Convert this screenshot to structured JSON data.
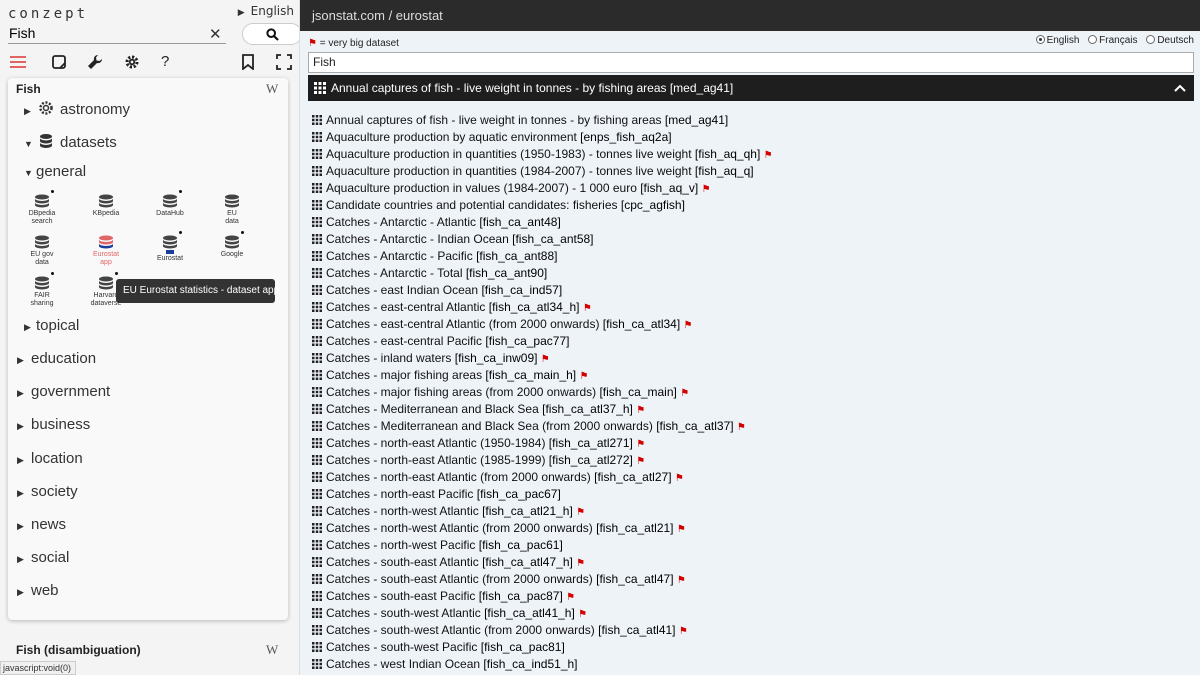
{
  "left": {
    "logo": "conzept",
    "language": "English",
    "search_value": "Fish",
    "card_title": "Fish",
    "wiki_letter": "W",
    "tree": {
      "astronomy": "astronomy",
      "datasets": "datasets",
      "general": "general",
      "topical": "topical",
      "education": "education",
      "government": "government",
      "business": "business",
      "location": "location",
      "society": "society",
      "news": "news",
      "social": "social",
      "web": "web"
    },
    "apps": [
      {
        "l1": "DBpedia",
        "l2": "search"
      },
      {
        "l1": "KBpedia",
        "l2": ""
      },
      {
        "l1": "DataHub",
        "l2": ""
      },
      {
        "l1": "EU",
        "l2": "data"
      },
      {
        "l1": "EU gov",
        "l2": "data"
      },
      {
        "l1": "Eurostat",
        "l2": "app"
      },
      {
        "l1": "Eurostat",
        "l2": ""
      },
      {
        "l1": "Google",
        "l2": ""
      },
      {
        "l1": "FAIR",
        "l2": "sharing"
      },
      {
        "l1": "Harvard",
        "l2": "dataverse"
      }
    ],
    "tooltip": "EU Eurostat statistics - dataset app",
    "disambiguation": "Fish (disambiguation)",
    "status": "javascript:void(0)"
  },
  "right": {
    "title": "jsonstat.com / eurostat",
    "legend": "= very big dataset",
    "languages": [
      "English",
      "Français",
      "Deutsch"
    ],
    "filter_value": "Fish",
    "selected": "Annual captures of fish - live weight in tonnes - by fishing areas [med_ag41]",
    "datasets": [
      {
        "text": "Annual captures of fish - live weight in tonnes - by fishing areas",
        "code": "[med_ag41]",
        "big": false
      },
      {
        "text": "Aquaculture production by aquatic environment",
        "code": "[enps_fish_aq2a]",
        "big": false
      },
      {
        "text": "Aquaculture production in quantities (1950-1983) - tonnes live weight",
        "code": "[fish_aq_qh]",
        "big": true
      },
      {
        "text": "Aquaculture production in quantities (1984-2007) - tonnes live weight",
        "code": "[fish_aq_q]",
        "big": false
      },
      {
        "text": "Aquaculture production in values (1984-2007) - 1 000 euro",
        "code": "[fish_aq_v]",
        "big": true
      },
      {
        "text": "Candidate countries and potential candidates: fisheries",
        "code": "[cpc_agfish]",
        "big": false
      },
      {
        "text": "Catches - Antarctic - Atlantic",
        "code": "[fish_ca_ant48]",
        "big": false
      },
      {
        "text": "Catches - Antarctic - Indian Ocean",
        "code": "[fish_ca_ant58]",
        "big": false
      },
      {
        "text": "Catches - Antarctic - Pacific",
        "code": "[fish_ca_ant88]",
        "big": false
      },
      {
        "text": "Catches - Antarctic - Total",
        "code": "[fish_ca_ant90]",
        "big": false
      },
      {
        "text": "Catches - east Indian Ocean",
        "code": "[fish_ca_ind57]",
        "big": false
      },
      {
        "text": "Catches - east-central Atlantic",
        "code": "[fish_ca_atl34_h]",
        "big": true
      },
      {
        "text": "Catches - east-central Atlantic (from 2000 onwards)",
        "code": "[fish_ca_atl34]",
        "big": true
      },
      {
        "text": "Catches - east-central Pacific",
        "code": "[fish_ca_pac77]",
        "big": false
      },
      {
        "text": "Catches - inland waters",
        "code": "[fish_ca_inw09]",
        "big": true
      },
      {
        "text": "Catches - major fishing areas",
        "code": "[fish_ca_main_h]",
        "big": true
      },
      {
        "text": "Catches - major fishing areas (from 2000 onwards)",
        "code": "[fish_ca_main]",
        "big": true
      },
      {
        "text": "Catches - Mediterranean and Black Sea",
        "code": "[fish_ca_atl37_h]",
        "big": true
      },
      {
        "text": "Catches - Mediterranean and Black Sea (from 2000 onwards)",
        "code": "[fish_ca_atl37]",
        "big": true
      },
      {
        "text": "Catches - north-east Atlantic (1950-1984)",
        "code": "[fish_ca_atl271]",
        "big": true
      },
      {
        "text": "Catches - north-east Atlantic (1985-1999)",
        "code": "[fish_ca_atl272]",
        "big": true
      },
      {
        "text": "Catches - north-east Atlantic (from 2000 onwards)",
        "code": "[fish_ca_atl27]",
        "big": true
      },
      {
        "text": "Catches - north-east Pacific",
        "code": "[fish_ca_pac67]",
        "big": false
      },
      {
        "text": "Catches - north-west Atlantic",
        "code": "[fish_ca_atl21_h]",
        "big": true
      },
      {
        "text": "Catches - north-west Atlantic (from 2000 onwards)",
        "code": "[fish_ca_atl21]",
        "big": true
      },
      {
        "text": "Catches - north-west Pacific",
        "code": "[fish_ca_pac61]",
        "big": false
      },
      {
        "text": "Catches - south-east Atlantic",
        "code": "[fish_ca_atl47_h]",
        "big": true
      },
      {
        "text": "Catches - south-east Atlantic (from 2000 onwards)",
        "code": "[fish_ca_atl47]",
        "big": true
      },
      {
        "text": "Catches - south-east Pacific",
        "code": "[fish_ca_pac87]",
        "big": true
      },
      {
        "text": "Catches - south-west Atlantic",
        "code": "[fish_ca_atl41_h]",
        "big": true
      },
      {
        "text": "Catches - south-west Atlantic (from 2000 onwards)",
        "code": "[fish_ca_atl41]",
        "big": true
      },
      {
        "text": "Catches - south-west Pacific",
        "code": "[fish_ca_pac81]",
        "big": false
      },
      {
        "text": "Catches - west Indian Ocean",
        "code": "[fish_ca_ind51_h]",
        "big": false
      }
    ]
  },
  "colors": {
    "accent": "#e06666",
    "flag": "#d40000",
    "topbar": "#2b2b2b",
    "main_bg": "#eef3f8"
  }
}
